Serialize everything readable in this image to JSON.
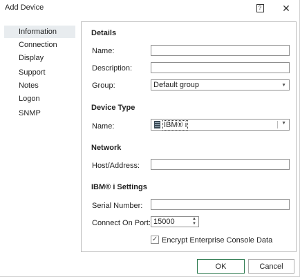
{
  "window": {
    "title": "Add Device",
    "help_label": "?",
    "close_label": "✕"
  },
  "sidebar": {
    "items": [
      {
        "label": "Information"
      },
      {
        "label": "Connection"
      },
      {
        "label": "Display"
      },
      {
        "label": "Support"
      },
      {
        "label": "Notes"
      },
      {
        "label": "Logon"
      },
      {
        "label": "SNMP"
      }
    ],
    "selected": "Information"
  },
  "details": {
    "title": "Details",
    "name_label": "Name:",
    "name_value": "",
    "description_label": "Description:",
    "description_value": "",
    "group_label": "Group:",
    "group_value": "Default group"
  },
  "device_type": {
    "title": "Device Type",
    "name_label": "Name:",
    "name_value": "IBM® i"
  },
  "network": {
    "title": "Network",
    "host_label": "Host/Address:",
    "host_value": ""
  },
  "ibm_settings": {
    "title": "IBM® i Settings",
    "serial_label": "Serial Number:",
    "serial_value": "",
    "port_label": "Connect On Port:",
    "port_value": "15000",
    "encrypt_label": "Encrypt Enterprise Console Data",
    "encrypt_checked": true
  },
  "buttons": {
    "ok": "OK",
    "cancel": "Cancel"
  },
  "icons": {
    "help": "help-icon",
    "close": "close-icon",
    "device": "server-icon",
    "dropdown": "chevron-down-icon",
    "spin": "spin-arrows-icon",
    "check": "checkmark-icon"
  }
}
